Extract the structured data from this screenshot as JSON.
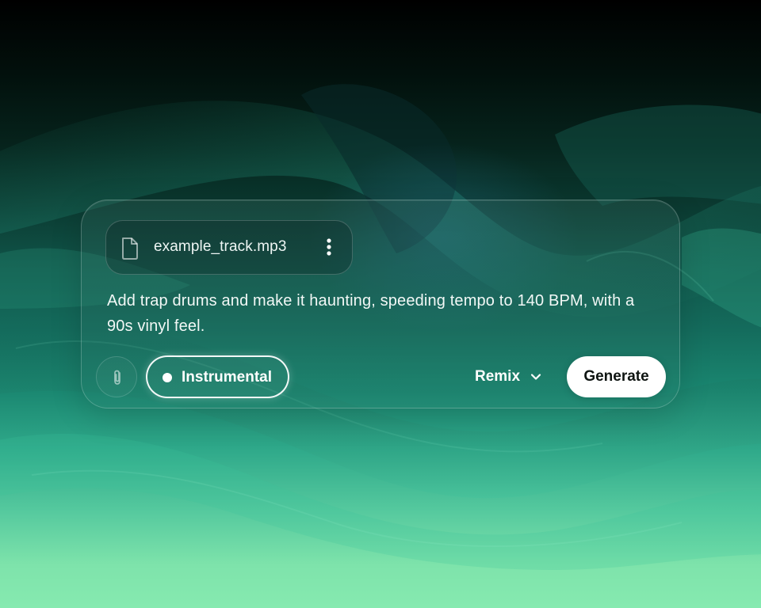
{
  "attachment": {
    "file_name": "example_track.mp3",
    "file_icon": "file-icon",
    "menu_icon": "more-vertical-icon"
  },
  "prompt": {
    "text": "Add trap drums and make it haunting, speeding tempo to 140 BPM, with a 90s vinyl feel."
  },
  "toolbar": {
    "attach_icon": "paperclip-icon",
    "instrumental_label": "Instrumental",
    "mode_label": "Remix",
    "mode_icon": "chevron-down-icon",
    "generate_label": "Generate"
  },
  "colors": {
    "background_top": "#000000",
    "background_mid": "#146b5c",
    "background_bottom": "#86eab0",
    "card_border": "#ffffff",
    "generate_button": "#ffffff",
    "generate_text": "#0f1512"
  }
}
